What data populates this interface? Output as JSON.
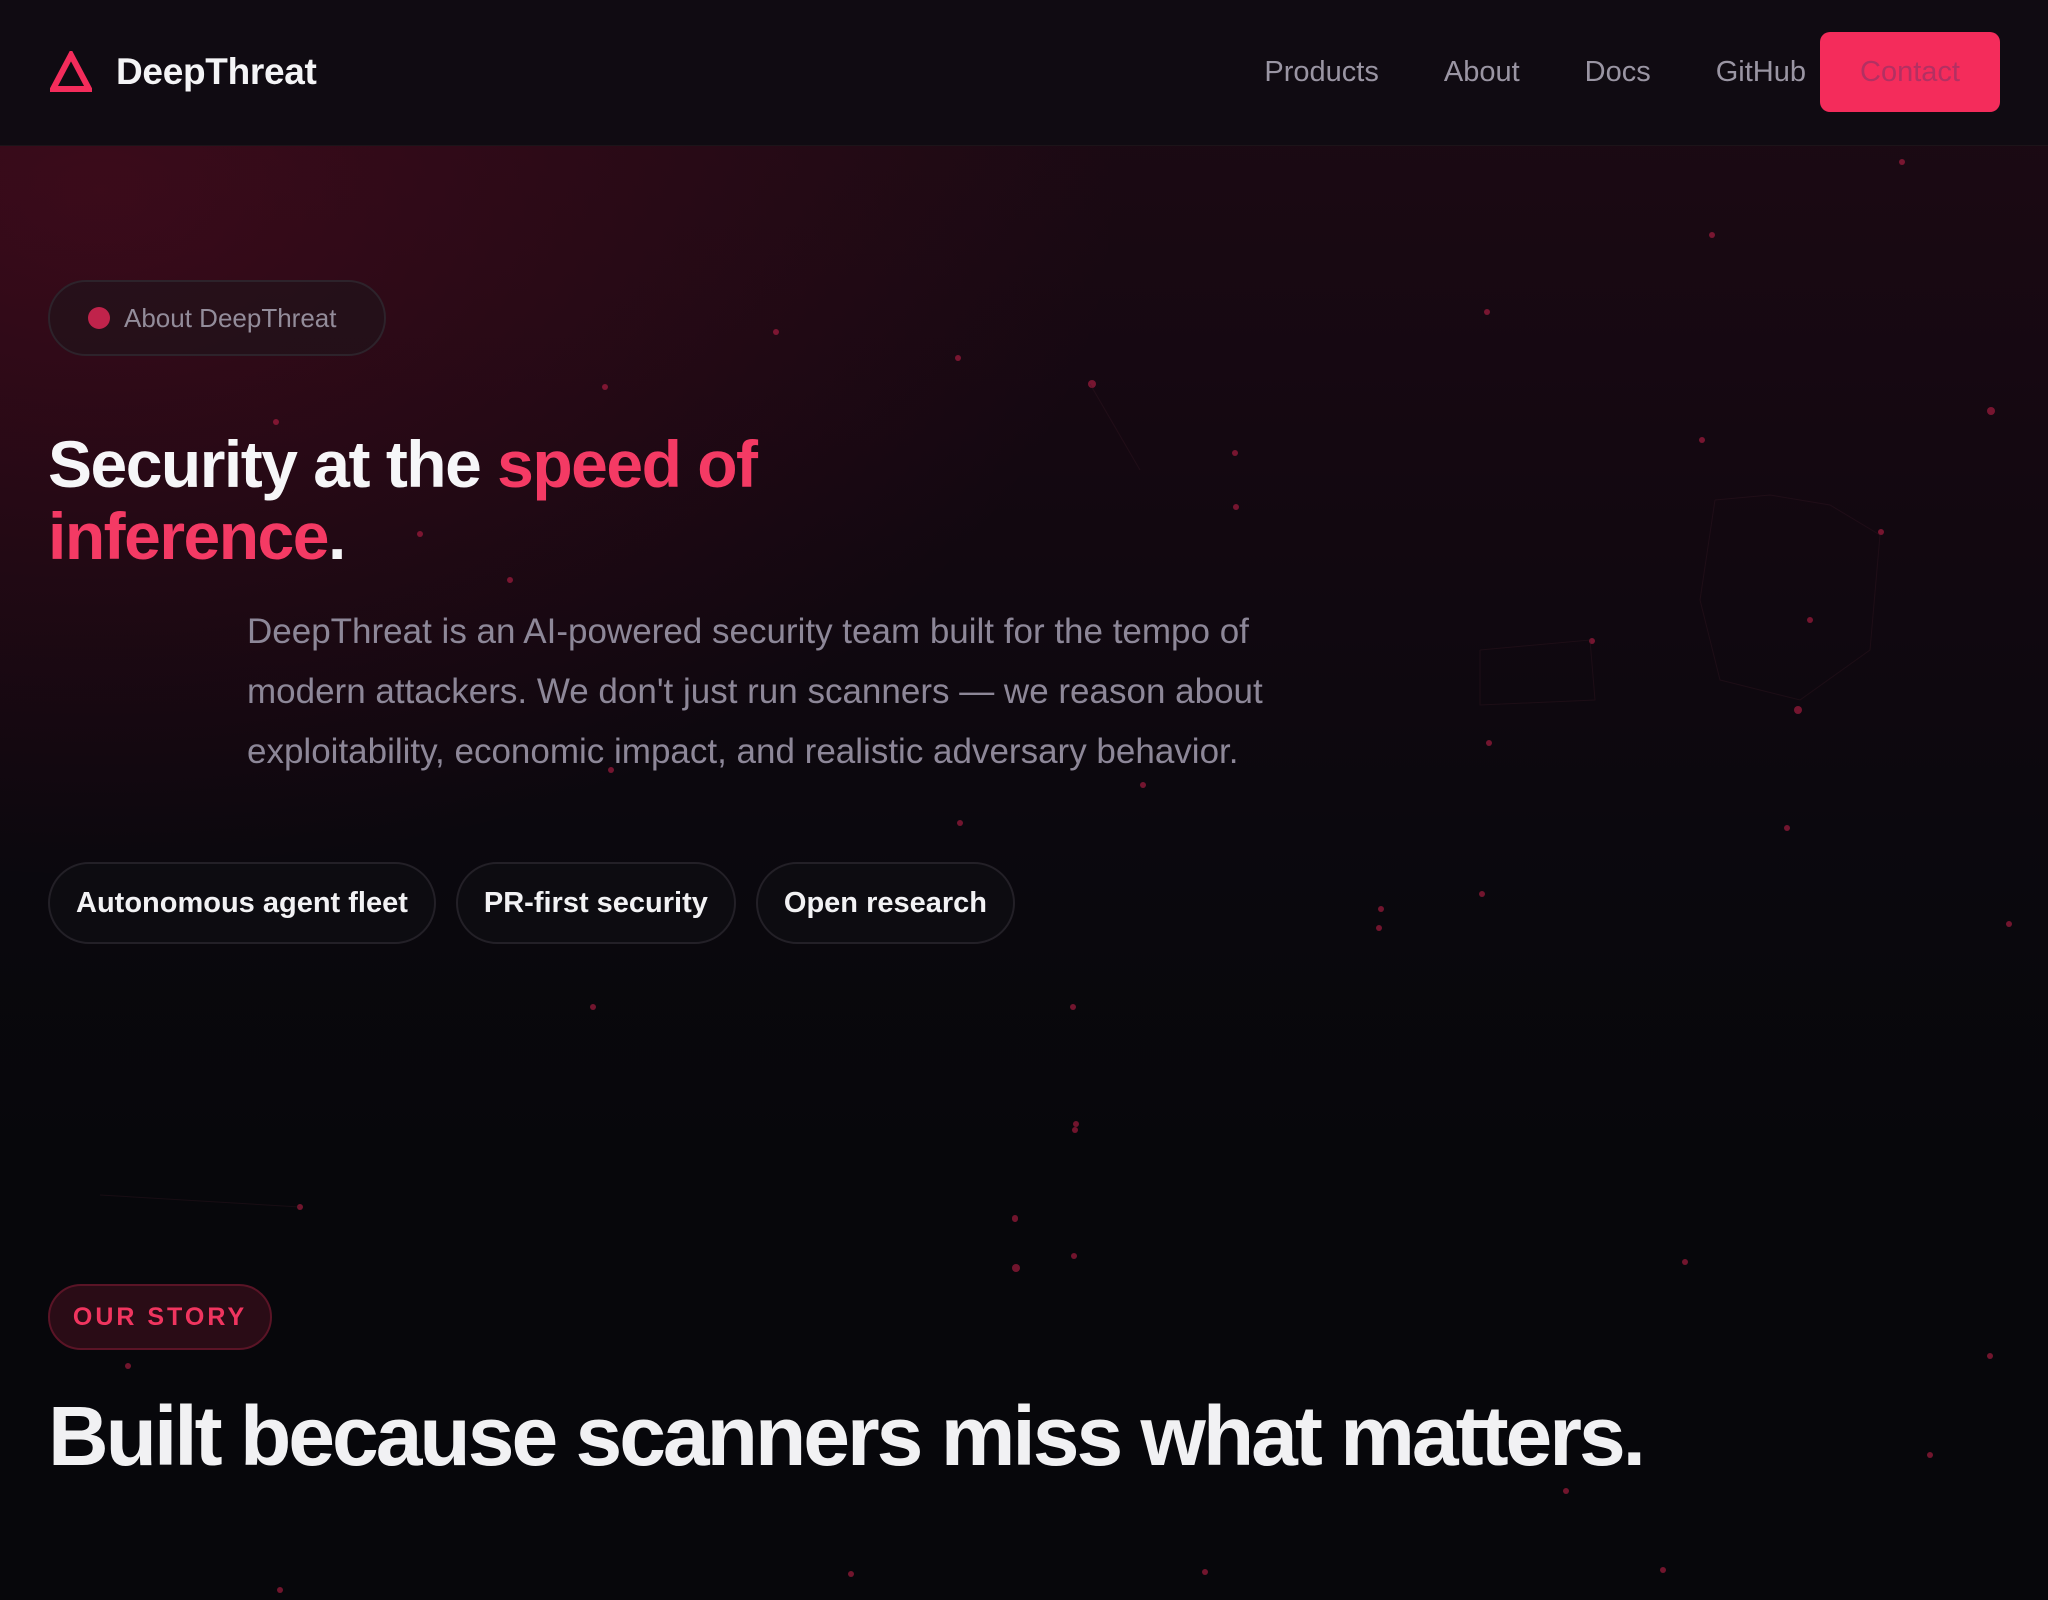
{
  "brand": {
    "name": "DeepThreat",
    "logo_icon": "triangle-logo-icon",
    "accent": "#f42c5b"
  },
  "nav": {
    "links": [
      "Products",
      "About",
      "Docs",
      "GitHub"
    ],
    "contact_label": "Contact"
  },
  "hero": {
    "badge": "About DeepThreat",
    "title_part1": "Security at the ",
    "title_accent": "speed of inference",
    "title_end": ".",
    "description": "DeepThreat is an AI-powered security team built for the tempo of modern attackers. We don't just run scanners — we reason about exploitability, economic impact, and realistic adversary behavior.",
    "chips": [
      "Autonomous agent fleet",
      "PR-first security",
      "Open research"
    ]
  },
  "story": {
    "badge": "OUR STORY",
    "title": "Built because scanners miss what matters."
  }
}
